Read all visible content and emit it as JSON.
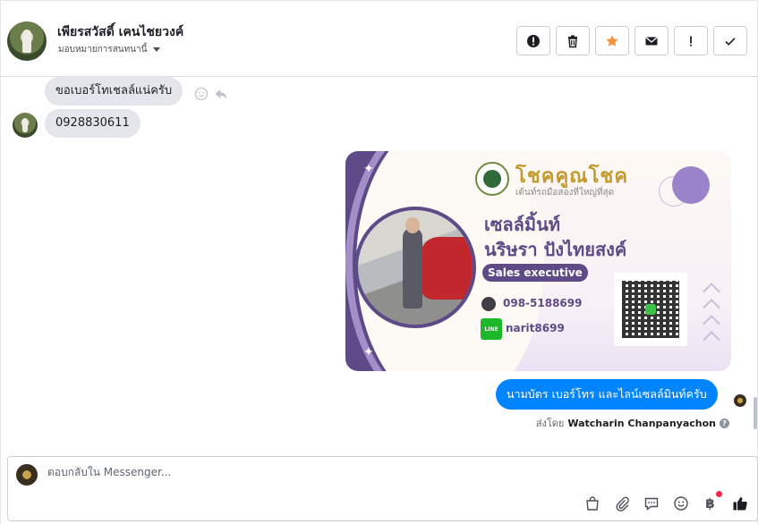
{
  "header": {
    "contact_name": "เพียรสวัสดิ์ เคนไชยวงค์",
    "assign_label": "มอบหมายการสนทนานี้",
    "actions": [
      "alert-icon",
      "trash-icon",
      "star-icon",
      "envelope-icon",
      "exclamation-icon",
      "check-icon"
    ]
  },
  "messages": {
    "incoming": [
      {
        "text": "ขอเบอร์โทเชลล์แน่ครับ"
      },
      {
        "text": "0928830611"
      }
    ],
    "card": {
      "brand_title": "โชคคูณโชค",
      "brand_tagline": "เต้นท์รถมือสองที่ใหญ่ที่สุด",
      "nickname": "เซลล์มิ้นท์",
      "full_name": "นริษรา ปังไทยสงค์",
      "role": "Sales executive",
      "phone": "098-5188699",
      "line_label": "LINE",
      "line_id": "narit8699"
    },
    "outgoing": {
      "text": "นามบัตร เบอร์โทร และไลน์เซลล์มินท์ครับ",
      "sent_by_label": "ส่งโดย",
      "sent_by_name": "Watcharin Chanpanyachon",
      "help": "?"
    }
  },
  "composer": {
    "placeholder": "ตอบกลับใน Messenger...",
    "currency_symbol": "฿",
    "tools": [
      "shop-icon",
      "attachment-icon",
      "saved-reply-icon",
      "emoji-icon",
      "payment-icon",
      "like-icon"
    ]
  },
  "colors": {
    "accent": "#0084ff",
    "card_purple": "#5d4a86",
    "brand_gold": "#c49a2c",
    "line_green": "#1cb82a"
  }
}
